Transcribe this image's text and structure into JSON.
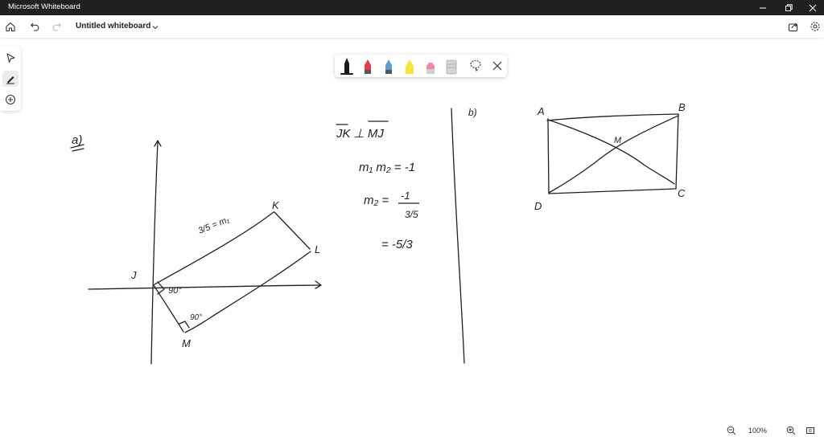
{
  "app": {
    "title": "Microsoft Whiteboard"
  },
  "toolbar": {
    "document_title": "Untitled whiteboard"
  },
  "zoom": {
    "value": "100%"
  },
  "pens": {
    "colors": [
      "#1a1a1a",
      "#e23d4d",
      "#5aa0d8",
      "#f2e63a",
      "#f08aa4",
      "#c8c8c8"
    ]
  },
  "canvas": {
    "labels": {
      "part_a": "a)",
      "part_b": "b)",
      "point_j": "J",
      "point_k": "K",
      "point_l": "L",
      "point_m": "M",
      "angle_1": "90°",
      "angle_2": "90°",
      "slope_label": "3/5 = m₁",
      "rect_a": "A",
      "rect_b": "B",
      "rect_c": "C",
      "rect_d": "D",
      "rect_m": "M"
    },
    "equations": {
      "line1": "JK ⊥ MJ",
      "line2": "m₁ m₂ = -1",
      "line3_lhs": "m₂ =",
      "line3_num": "-1",
      "line3_den": "3/5",
      "line4": "= -5/3"
    }
  }
}
